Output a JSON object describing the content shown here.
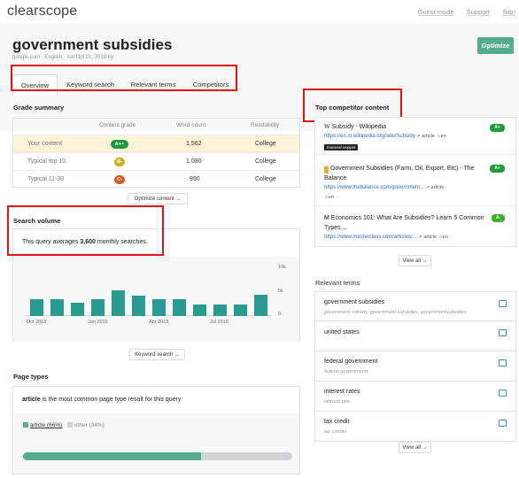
{
  "app": {
    "logo": "clearscope",
    "nav": [
      "Guest mode",
      "Support",
      "Sign"
    ]
  },
  "header": {
    "title": "government subsidies",
    "meta": "google.com · English · run Oct 21, 2019 by",
    "optimize": "Optimize",
    "tabs": [
      "Overview",
      "Keyword search",
      "Relevant terms",
      "Competitors"
    ]
  },
  "grade": {
    "title": "Grade summary",
    "columns": [
      "Content grade",
      "Word count",
      "Readability"
    ],
    "rows": [
      {
        "label": "Your content",
        "grade": "A++",
        "words": "1,562",
        "read": "College",
        "color": "#1e9c3c"
      },
      {
        "label": "Typical top 10",
        "grade": "B-",
        "words": "1,080",
        "read": "College",
        "color": "#c9b31b"
      },
      {
        "label": "Typical 11-30",
        "grade": "C-",
        "words": "990",
        "read": "College",
        "color": "#d65a25"
      }
    ],
    "button": "Optimize content →"
  },
  "volume": {
    "title": "Search volume",
    "text_pre": "This query averages ",
    "value": "3,600",
    "text_post": " monthly searches.",
    "y_ticks": [
      "10k",
      "5k",
      "0"
    ],
    "x_ticks": [
      "Oct 2018",
      "Jan 2019",
      "Apr 2019",
      "Jul 2019"
    ],
    "button": "Keyword search →"
  },
  "chart_data": {
    "type": "bar",
    "ylim": [
      0,
      10000
    ],
    "ylabel_ticks": [
      "10k",
      "5k",
      "0"
    ],
    "values": [
      3500,
      3500,
      2800,
      3500,
      5300,
      4200,
      3500,
      3500,
      2400,
      2400,
      2400,
      4300
    ]
  },
  "pagetypes": {
    "title": "Page types",
    "lead_bold": "article",
    "lead_rest": " is the most common page type result for this query",
    "legend": [
      {
        "label": "article (66%)",
        "color": "#55ad8e"
      },
      {
        "label": "other (34%)",
        "color": "#d0d4d7"
      }
    ],
    "article_share": 0.66
  },
  "competitors": {
    "title": "Top competitor content",
    "items": [
      {
        "icon": "W",
        "title": "Subsidy - Wikipedia",
        "url": "https://en.m.wikipedia.org/wiki/Subsidy",
        "type": "article",
        "lang": "en",
        "grade": "A+",
        "snippet": "featured snippet"
      },
      {
        "icon": "B",
        "title": "Government Subsidies (Farm, Oil, Export, Etc) - The Balance",
        "url": "https://www.thebalance.com/government...",
        "type": "article",
        "lang": "en",
        "grade": "A+"
      },
      {
        "icon": "M",
        "title": "Economics 101: What Are Subsidies? Learn 5 Common Types ...",
        "url": "https://www.masterclass.com/articles/...",
        "type": "article",
        "lang": "en",
        "grade": "A-"
      }
    ],
    "view_all": "View all →"
  },
  "terms": {
    "title": "Relevant terms",
    "items": [
      {
        "t": "government subsidies",
        "s": "government subsidy, government-subsidies, governmentsubsidies"
      },
      {
        "t": "united states",
        "s": ""
      },
      {
        "t": "federal government",
        "s": "federal governments"
      },
      {
        "t": "interest rates",
        "s": "interest rate"
      },
      {
        "t": "tax credit",
        "s": "tax credits"
      }
    ],
    "view_all": "View all →"
  }
}
